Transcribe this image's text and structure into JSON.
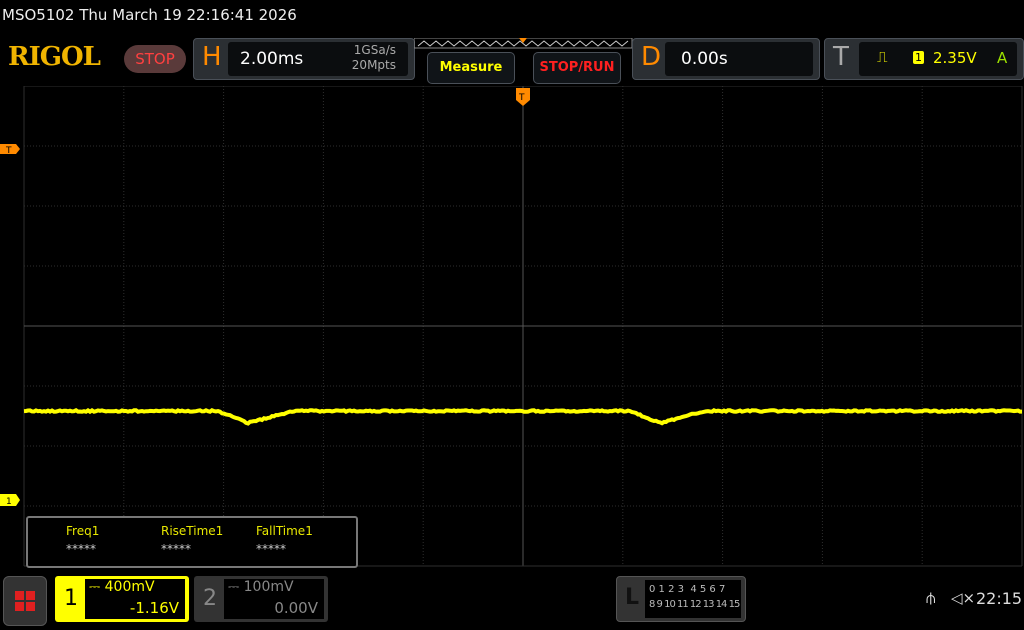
{
  "title": "MSO5102  Thu March 19 22:16:41 2026",
  "logo": "RIGOL",
  "run_state": "STOP",
  "horizontal": {
    "label": "H",
    "timebase": "2.00ms",
    "sample_rate": "1GSa/s",
    "memory_depth": "20Mpts"
  },
  "buttons": {
    "measure": "Measure",
    "stop_run": "STOP/RUN"
  },
  "delay": {
    "label": "D",
    "value": "0.00s"
  },
  "trigger": {
    "label": "T",
    "source": "1",
    "level": "2.35V",
    "mode": "A",
    "marker": "T"
  },
  "measurements": [
    {
      "name": "Freq1",
      "value": "*****"
    },
    {
      "name": "RiseTime1",
      "value": "*****"
    },
    {
      "name": "FallTime1",
      "value": "*****"
    }
  ],
  "channels": [
    {
      "number": "1",
      "scale": "400mV",
      "offset": "-1.16V",
      "color": "#ffff00"
    },
    {
      "number": "2",
      "scale": "100mV",
      "offset": "0.00V",
      "color": "#888888"
    }
  ],
  "logic": {
    "label": "L",
    "row1": "0 1 2 3  4 5 6 7",
    "row2": "8 9 10 11 12 13 14 15"
  },
  "status": {
    "time": "22:15",
    "icons": [
      "usb-icon",
      "speaker-muted-icon"
    ]
  },
  "colors": {
    "ch1": "#ffff00",
    "accent": "#ff8a00",
    "grid": "#3a3a3a"
  }
}
